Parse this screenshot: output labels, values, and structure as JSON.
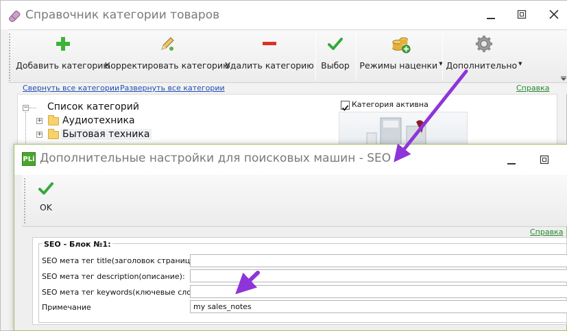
{
  "main_window": {
    "title": "Справочник категории товаров",
    "toolbar": {
      "add_label": "Добавить категорию",
      "edit_label": "Корректировать категорию",
      "delete_label": "Удалить категорию",
      "select_label": "Выбор",
      "markup_label": "Режимы наценки",
      "more_label": "Дополнительно"
    },
    "links": {
      "collapse_all": "Свернуть все категории",
      "expand_all": "Развернуть все категории",
      "help": "Справка"
    },
    "tree": {
      "root": "Список категорий",
      "items": [
        "Аудиотехника",
        "Бытовая техника"
      ]
    },
    "category_active": {
      "label": "Категория активна",
      "checked": true
    },
    "icons": {
      "add": "plus-icon",
      "edit": "pencil-icon",
      "delete": "minus-icon",
      "select": "checkmark-icon",
      "markup": "coins-icon",
      "more": "gear-icon"
    }
  },
  "seo_dialog": {
    "title": "Дополнительные настройки для поисковых машин - SEO",
    "title_icon_text": "PLi",
    "toolbar": {
      "ok_label": "OK"
    },
    "help": "Справка",
    "group": {
      "legend": "SEO - Блок №1:",
      "fields": [
        {
          "label": "SEO мета тег title(заголовок страницы):",
          "value": ""
        },
        {
          "label": "SEO мета тег description(описание):",
          "value": ""
        },
        {
          "label": "SEO мета тег keywords(ключевые слова):",
          "value": ""
        },
        {
          "label": "Примечание",
          "value": "my sales_notes"
        }
      ]
    }
  },
  "colors": {
    "link_blue": "#1d4eb1",
    "link_green": "#238a2e",
    "annotation_arrow": "#8e35d9",
    "dialog_border": "#9fbf63"
  }
}
